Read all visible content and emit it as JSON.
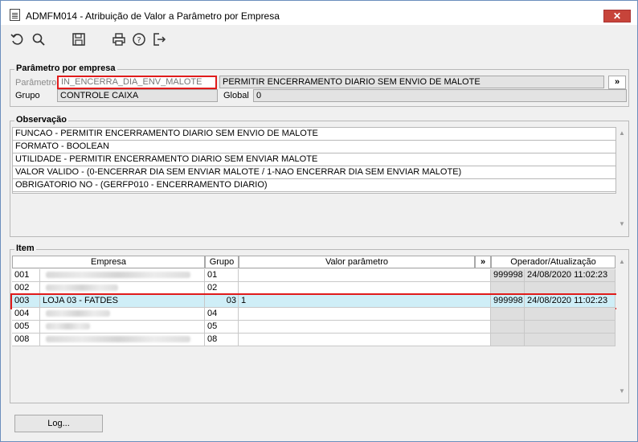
{
  "window": {
    "title": "ADMFM014 - Atribuição de Valor a Parâmetro por Empresa",
    "close_label": "✕"
  },
  "toolbar": {
    "icons": [
      "undo-icon",
      "search-icon",
      "save-icon",
      "print-icon",
      "help-icon",
      "exit-icon"
    ]
  },
  "param_group": {
    "title": "Parâmetro por empresa",
    "param_label": "Parâmetro",
    "param_value": "IN_ENCERRA_DIA_ENV_MALOTE",
    "param_desc": "PERMITIR ENCERRAMENTO DIARIO SEM ENVIO DE MALOTE",
    "expand_label": "»",
    "group_label": "Grupo",
    "group_value": "CONTROLE CAIXA",
    "global_label": "Global",
    "global_value": "0"
  },
  "obs_group": {
    "title": "Observação",
    "lines": [
      "FUNCAO - PERMITIR ENCERRAMENTO DIARIO SEM ENVIO DE MALOTE",
      "FORMATO - BOOLEAN",
      "UTILIDADE - PERMITIR ENCERRAMENTO DIARIO SEM ENVIAR MALOTE",
      "VALOR VALIDO - (0-ENCERRAR DIA SEM ENVIAR MALOTE / 1-NAO ENCERRAR DIA SEM ENVIAR MALOTE)",
      "OBRIGATORIO NO -  (GERFP010 - ENCERRAMENTO DIARIO)"
    ]
  },
  "item_group": {
    "title": "Item",
    "headers": {
      "empresa": "Empresa",
      "grupo": "Grupo",
      "valor": "Valor parâmetro",
      "expand": "»",
      "operador": "Operador/Atualização"
    },
    "rows": [
      {
        "code": "001",
        "empresa": "",
        "grupo": "01",
        "valor": "",
        "operador": "999998",
        "atualizacao": "24/08/2020 11:02:23"
      },
      {
        "code": "002",
        "empresa": "",
        "grupo": "02",
        "valor": "",
        "operador": "",
        "atualizacao": ""
      },
      {
        "code": "003",
        "empresa": "LOJA 03 - FATDES",
        "grupo": "03",
        "valor": "1",
        "operador": "999998",
        "atualizacao": "24/08/2020 11:02:23"
      },
      {
        "code": "004",
        "empresa": "",
        "grupo": "04",
        "valor": "",
        "operador": "",
        "atualizacao": ""
      },
      {
        "code": "005",
        "empresa": "",
        "grupo": "05",
        "valor": "",
        "operador": "",
        "atualizacao": ""
      },
      {
        "code": "008",
        "empresa": "",
        "grupo": "08",
        "valor": "",
        "operador": "",
        "atualizacao": ""
      }
    ]
  },
  "footer": {
    "log_label": "Log..."
  }
}
